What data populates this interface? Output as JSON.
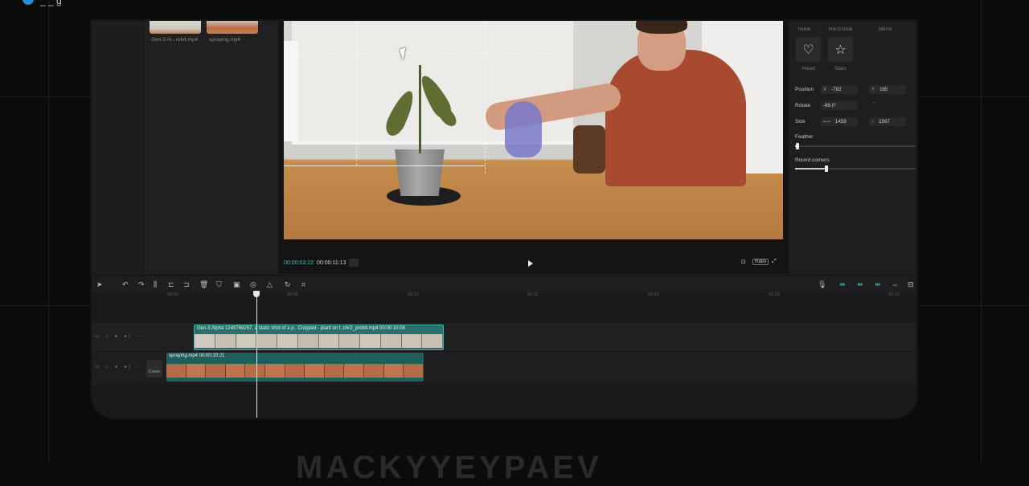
{
  "top": {
    "title_fragment": "_ _ g"
  },
  "media": {
    "clips": [
      {
        "label": "Gen-3 Al...rob4.mp4"
      },
      {
        "label": "spraying.mp4"
      }
    ]
  },
  "player": {
    "current_time": "00:00:03:22",
    "total_time": "00:00:11:13",
    "ratio_label": "Ratio"
  },
  "mask_panel": {
    "tabs": [
      "None",
      "Horizontal",
      "Mirror"
    ],
    "shapes": [
      {
        "label": "Heart",
        "icon": "heart-icon"
      },
      {
        "label": "Stars",
        "icon": "star-icon"
      }
    ],
    "position_label": "Position",
    "position_x": "-782",
    "position_y": "165",
    "x_prefix": "X",
    "y_prefix": "Y",
    "rotate_label": "Rotate",
    "rotate_value": "-86.0°",
    "size_label": "Size",
    "size_w": "1459",
    "size_h": "1567",
    "feather_label": "Feather",
    "feather_level": 0.02,
    "round_label": "Round corners",
    "round_level": 0.26
  },
  "timeline": {
    "ruler": [
      "00:00",
      "00:05",
      "00:10",
      "00:15",
      "00:20",
      "00:25",
      "00:30"
    ],
    "clip1_title": "Gen-3 Alpha 1240769257, a static shot of a p.. Cropped - plant on t..chr2_prob4.mp4  00:00:10:08",
    "clip2_title": "spraying.mp4  00:00:10:21",
    "cover_label": "Cover"
  },
  "watermark": "MACKYYEYPAEV"
}
